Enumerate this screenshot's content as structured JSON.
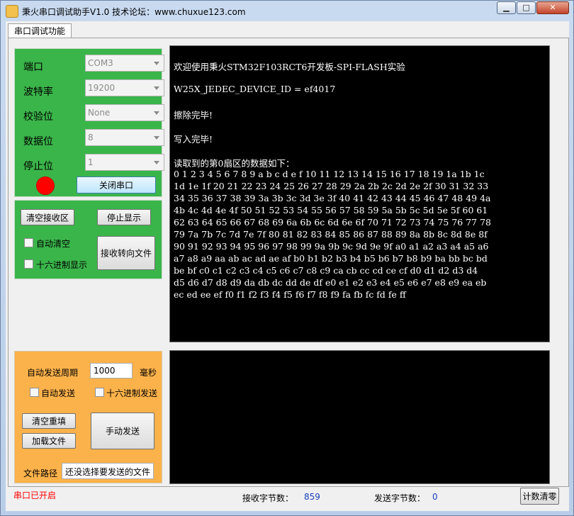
{
  "window": {
    "title": "秉火串口调试助手V1.0    技术论坛：www.chuxue123.com"
  },
  "tab": {
    "label": "串口调试功能"
  },
  "port_settings": {
    "port": {
      "label": "端口",
      "value": "COM3"
    },
    "baud": {
      "label": "波特率",
      "value": "19200"
    },
    "parity": {
      "label": "校验位",
      "value": "None"
    },
    "databits": {
      "label": "数据位",
      "value": "8"
    },
    "stopbits": {
      "label": "停止位",
      "value": "1"
    },
    "close_port_label": "关闭串口",
    "led_color": "#ff0000"
  },
  "receive_settings": {
    "clear_receive": "清空接收区",
    "stop_display": "停止显示",
    "auto_clear": "自动清空",
    "hex_display": "十六进制显示",
    "redirect_to_file": "接收转向文件"
  },
  "receive_text": [
    "欢迎使用秉火STM32F103RCT6开发板-SPI-FLASH实验",
    "W25X_JEDEC_DEVICE_ID = ef4017",
    "擦除完毕!",
    "写入完毕!",
    "读取到的第0扇区的数据如下：",
    "0 1 2 3 4 5 6 7 8 9 a b c d e f 10 11 12 13 14 15 16 17 18 19 1a 1b 1c",
    "1d 1e 1f 20 21 22 23 24 25 26 27 28 29 2a 2b 2c 2d 2e 2f 30 31 32 33",
    "34 35 36 37 38 39 3a 3b 3c 3d 3e 3f 40 41 42 43 44 45 46 47 48 49 4a",
    "4b 4c 4d 4e 4f 50 51 52 53 54 55 56 57 58 59 5a 5b 5c 5d 5e 5f 60 61",
    "62 63 64 65 66 67 68 69 6a 6b 6c 6d 6e 6f 70 71 72 73 74 75 76 77 78",
    "79 7a 7b 7c 7d 7e 7f 80 81 82 83 84 85 86 87 88 89 8a 8b 8c 8d 8e 8f",
    "90 91 92 93 94 95 96 97 98 99 9a 9b 9c 9d 9e 9f a0 a1 a2 a3 a4 a5 a6",
    "a7 a8 a9 aa ab ac ad ae af b0 b1 b2 b3 b4 b5 b6 b7 b8 b9 ba bb bc bd",
    "be bf c0 c1 c2 c3 c4 c5 c6 c7 c8 c9 ca cb cc cd ce cf d0 d1 d2 d3 d4",
    "d5 d6 d7 d8 d9 da db dc dd de df e0 e1 e2 e3 e4 e5 e6 e7 e8 e9 ea eb",
    "ec ed ee ef f0 f1 f2 f3 f4 f5 f6 f7 f8 f9 fa fb fc fd fe ff"
  ],
  "send_settings": {
    "period_label": "自动发送周期",
    "period_value": "1000",
    "period_unit": "毫秒",
    "auto_send": "自动发送",
    "hex_send": "十六进制发送",
    "clear_refill": "清空重填",
    "load_file": "加载文件",
    "manual_send": "手动发送",
    "file_path_label": "文件路径",
    "file_path_value": "还没选择要发送的文件"
  },
  "status_bar": {
    "port_status": "串口已开启",
    "port_status_color": "#ff0000",
    "rx_label": "接收字节数：",
    "rx_count": "859",
    "tx_label": "发送字节数：",
    "tx_count": "0",
    "reset_count": "计数清零"
  }
}
